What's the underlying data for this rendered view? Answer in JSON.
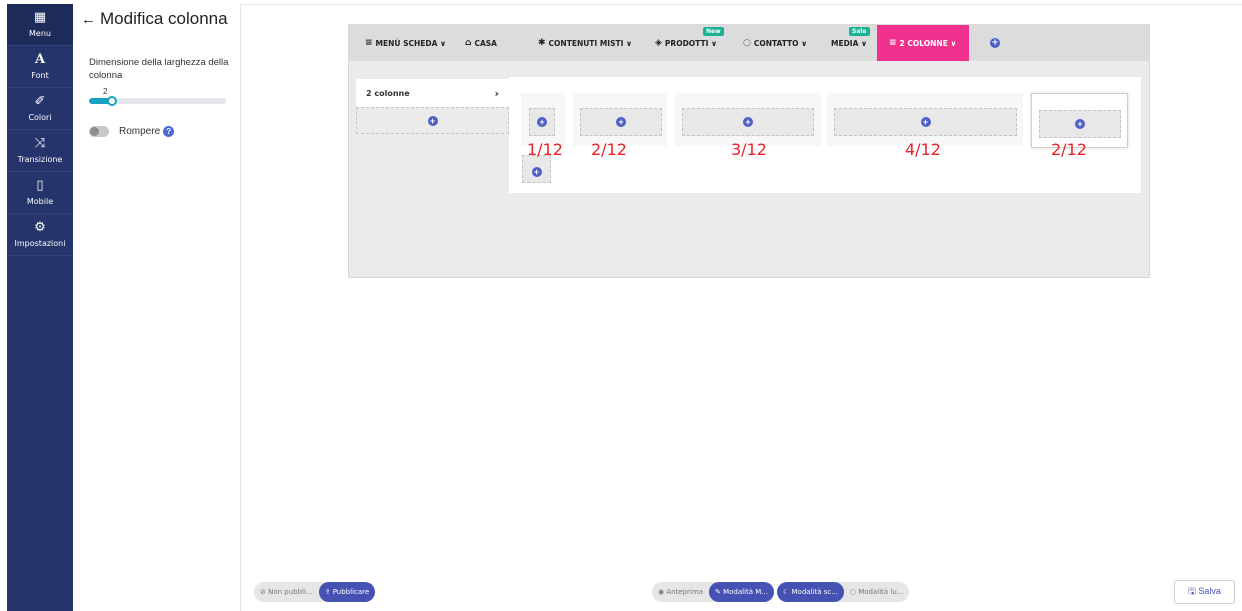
{
  "sidebar": {
    "items": [
      {
        "icon": "grid-icon",
        "glyph": "▦",
        "label": "Menu"
      },
      {
        "icon": "font-icon",
        "glyph": "A",
        "label": "Font"
      },
      {
        "icon": "brush-icon",
        "glyph": "✐",
        "label": "Colori"
      },
      {
        "icon": "shuffle-icon",
        "glyph": "⤨",
        "label": "Transizione"
      },
      {
        "icon": "mobile-icon",
        "glyph": "▯",
        "label": "Mobile"
      },
      {
        "icon": "gear-icon",
        "glyph": "⚙",
        "label": "Impostazioni"
      }
    ]
  },
  "panel": {
    "back_glyph": "←",
    "title": "Modifica colonna",
    "width_label": "Dimensione della larghezza della colonna",
    "slider_value": "2",
    "slider_fraction": 0.167,
    "break_label": "Rompere",
    "help_glyph": "?"
  },
  "menubar": {
    "items": [
      {
        "glyph": "≡",
        "label": "MENÙ SCHEDA ∨"
      },
      {
        "glyph": "⌂",
        "label": "CASA"
      },
      {
        "glyph": "✱",
        "label": "CONTENUTI MISTI ∨"
      },
      {
        "glyph": "◈",
        "label": "PRODOTTI ∨",
        "badge": "New"
      },
      {
        "glyph": "◌",
        "label": "CONTATTO ∨"
      },
      {
        "glyph": "",
        "label": "MEDIA ∨",
        "badge": "Sale"
      },
      {
        "glyph": "≡",
        "label": "2 COLONNE ∨"
      }
    ],
    "add_glyph": "+"
  },
  "submenu": {
    "label": "2 colonne",
    "chevron": "›",
    "add_glyph": "+"
  },
  "columns": [
    {
      "fraction": "1/12",
      "add_glyph": "+"
    },
    {
      "fraction": "2/12",
      "add_glyph": "+"
    },
    {
      "fraction": "3/12",
      "add_glyph": "+"
    },
    {
      "fraction": "4/12",
      "add_glyph": "+"
    },
    {
      "fraction": "2/12",
      "add_glyph": "+"
    }
  ],
  "extra_add_glyph": "+",
  "colors": {
    "rail": "#25356b",
    "accent": "#4552b3",
    "active_menu": "#f0318e",
    "badge_new": "#19b394",
    "badge_sale": "#19b394",
    "fraction_text": "#e8222a",
    "slider": "#19a1c4"
  },
  "bottombar": {
    "unpublished": "⊘ Non pubbli...",
    "publish": "⇪ Pubblicare",
    "preview": "◉ Anteprima",
    "edit_mode": "✎ Modalità M...",
    "dark_mode": "☾ Modalità sc...",
    "light_mode": "○ Modalità lu...",
    "save": "🖫 Salva"
  }
}
